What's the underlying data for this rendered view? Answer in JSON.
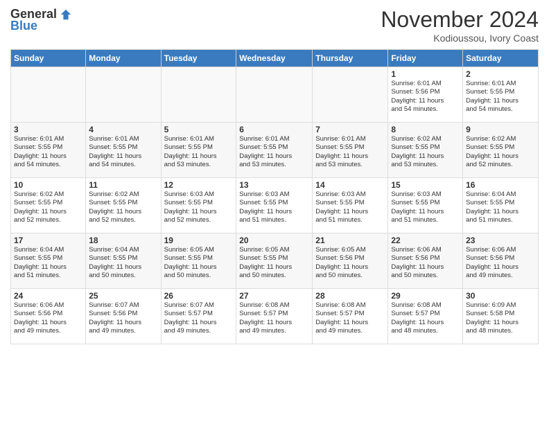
{
  "header": {
    "logo_general": "General",
    "logo_blue": "Blue",
    "month_title": "November 2024",
    "location": "Kodioussou, Ivory Coast"
  },
  "weekdays": [
    "Sunday",
    "Monday",
    "Tuesday",
    "Wednesday",
    "Thursday",
    "Friday",
    "Saturday"
  ],
  "weeks": [
    [
      {
        "day": "",
        "info": ""
      },
      {
        "day": "",
        "info": ""
      },
      {
        "day": "",
        "info": ""
      },
      {
        "day": "",
        "info": ""
      },
      {
        "day": "",
        "info": ""
      },
      {
        "day": "1",
        "info": "Sunrise: 6:01 AM\nSunset: 5:56 PM\nDaylight: 11 hours\nand 54 minutes."
      },
      {
        "day": "2",
        "info": "Sunrise: 6:01 AM\nSunset: 5:55 PM\nDaylight: 11 hours\nand 54 minutes."
      }
    ],
    [
      {
        "day": "3",
        "info": "Sunrise: 6:01 AM\nSunset: 5:55 PM\nDaylight: 11 hours\nand 54 minutes."
      },
      {
        "day": "4",
        "info": "Sunrise: 6:01 AM\nSunset: 5:55 PM\nDaylight: 11 hours\nand 54 minutes."
      },
      {
        "day": "5",
        "info": "Sunrise: 6:01 AM\nSunset: 5:55 PM\nDaylight: 11 hours\nand 53 minutes."
      },
      {
        "day": "6",
        "info": "Sunrise: 6:01 AM\nSunset: 5:55 PM\nDaylight: 11 hours\nand 53 minutes."
      },
      {
        "day": "7",
        "info": "Sunrise: 6:01 AM\nSunset: 5:55 PM\nDaylight: 11 hours\nand 53 minutes."
      },
      {
        "day": "8",
        "info": "Sunrise: 6:02 AM\nSunset: 5:55 PM\nDaylight: 11 hours\nand 53 minutes."
      },
      {
        "day": "9",
        "info": "Sunrise: 6:02 AM\nSunset: 5:55 PM\nDaylight: 11 hours\nand 52 minutes."
      }
    ],
    [
      {
        "day": "10",
        "info": "Sunrise: 6:02 AM\nSunset: 5:55 PM\nDaylight: 11 hours\nand 52 minutes."
      },
      {
        "day": "11",
        "info": "Sunrise: 6:02 AM\nSunset: 5:55 PM\nDaylight: 11 hours\nand 52 minutes."
      },
      {
        "day": "12",
        "info": "Sunrise: 6:03 AM\nSunset: 5:55 PM\nDaylight: 11 hours\nand 52 minutes."
      },
      {
        "day": "13",
        "info": "Sunrise: 6:03 AM\nSunset: 5:55 PM\nDaylight: 11 hours\nand 51 minutes."
      },
      {
        "day": "14",
        "info": "Sunrise: 6:03 AM\nSunset: 5:55 PM\nDaylight: 11 hours\nand 51 minutes."
      },
      {
        "day": "15",
        "info": "Sunrise: 6:03 AM\nSunset: 5:55 PM\nDaylight: 11 hours\nand 51 minutes."
      },
      {
        "day": "16",
        "info": "Sunrise: 6:04 AM\nSunset: 5:55 PM\nDaylight: 11 hours\nand 51 minutes."
      }
    ],
    [
      {
        "day": "17",
        "info": "Sunrise: 6:04 AM\nSunset: 5:55 PM\nDaylight: 11 hours\nand 51 minutes."
      },
      {
        "day": "18",
        "info": "Sunrise: 6:04 AM\nSunset: 5:55 PM\nDaylight: 11 hours\nand 50 minutes."
      },
      {
        "day": "19",
        "info": "Sunrise: 6:05 AM\nSunset: 5:55 PM\nDaylight: 11 hours\nand 50 minutes."
      },
      {
        "day": "20",
        "info": "Sunrise: 6:05 AM\nSunset: 5:55 PM\nDaylight: 11 hours\nand 50 minutes."
      },
      {
        "day": "21",
        "info": "Sunrise: 6:05 AM\nSunset: 5:56 PM\nDaylight: 11 hours\nand 50 minutes."
      },
      {
        "day": "22",
        "info": "Sunrise: 6:06 AM\nSunset: 5:56 PM\nDaylight: 11 hours\nand 50 minutes."
      },
      {
        "day": "23",
        "info": "Sunrise: 6:06 AM\nSunset: 5:56 PM\nDaylight: 11 hours\nand 49 minutes."
      }
    ],
    [
      {
        "day": "24",
        "info": "Sunrise: 6:06 AM\nSunset: 5:56 PM\nDaylight: 11 hours\nand 49 minutes."
      },
      {
        "day": "25",
        "info": "Sunrise: 6:07 AM\nSunset: 5:56 PM\nDaylight: 11 hours\nand 49 minutes."
      },
      {
        "day": "26",
        "info": "Sunrise: 6:07 AM\nSunset: 5:57 PM\nDaylight: 11 hours\nand 49 minutes."
      },
      {
        "day": "27",
        "info": "Sunrise: 6:08 AM\nSunset: 5:57 PM\nDaylight: 11 hours\nand 49 minutes."
      },
      {
        "day": "28",
        "info": "Sunrise: 6:08 AM\nSunset: 5:57 PM\nDaylight: 11 hours\nand 49 minutes."
      },
      {
        "day": "29",
        "info": "Sunrise: 6:08 AM\nSunset: 5:57 PM\nDaylight: 11 hours\nand 48 minutes."
      },
      {
        "day": "30",
        "info": "Sunrise: 6:09 AM\nSunset: 5:58 PM\nDaylight: 11 hours\nand 48 minutes."
      }
    ]
  ]
}
